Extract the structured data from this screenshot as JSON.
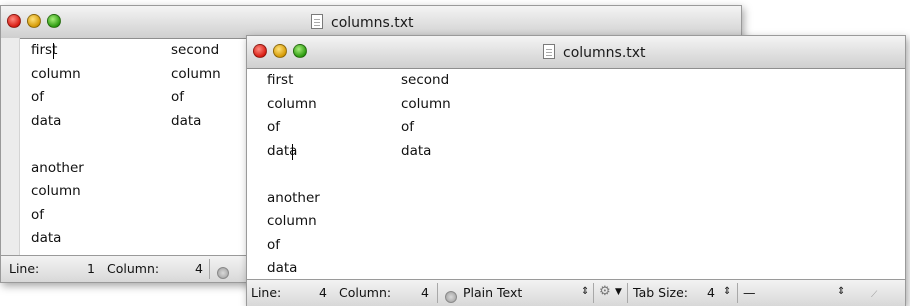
{
  "back_window": {
    "title": "columns.txt",
    "lines": [
      {
        "c1": "first",
        "c2": "second"
      },
      {
        "c1": "column",
        "c2": "column"
      },
      {
        "c1": "of",
        "c2": "of"
      },
      {
        "c1": "data",
        "c2": "data"
      },
      {
        "c1": "",
        "c2": ""
      },
      {
        "c1": "another",
        "c2": ""
      },
      {
        "c1": "column",
        "c2": ""
      },
      {
        "c1": "of",
        "c2": ""
      },
      {
        "c1": "data",
        "c2": ""
      }
    ],
    "status": {
      "line_label": "Line:",
      "line_value": "1",
      "column_label": "Column:",
      "column_value": "4"
    }
  },
  "front_window": {
    "title": "columns.txt",
    "lines": [
      {
        "c1": "first",
        "c2": "second"
      },
      {
        "c1": "column",
        "c2": "column"
      },
      {
        "c1": "of",
        "c2": "of"
      },
      {
        "c1": "data",
        "c2": "data"
      },
      {
        "c1": "",
        "c2": ""
      },
      {
        "c1": "another",
        "c2": ""
      },
      {
        "c1": "column",
        "c2": ""
      },
      {
        "c1": "of",
        "c2": ""
      },
      {
        "c1": "data",
        "c2": ""
      }
    ],
    "status": {
      "line_label": "Line:",
      "line_value": "4",
      "column_label": "Column:",
      "column_value": "4",
      "language": "Plain Text",
      "tab_size_label": "Tab Size:",
      "tab_size_value": "4",
      "symbol": "—"
    }
  }
}
